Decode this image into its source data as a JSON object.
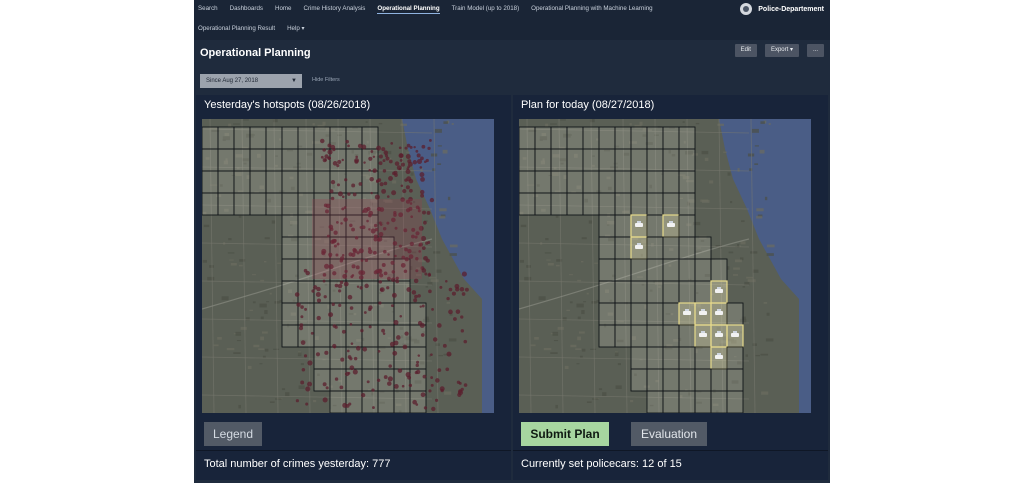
{
  "nav": {
    "row1": [
      "Search",
      "Dashboards",
      "Home",
      "Crime History Analysis",
      "Operational Planning",
      "Train Model (up to 2018)",
      "Operational Planning with Machine Learning"
    ],
    "row2": [
      "Operational Planning Result",
      "Help ▾"
    ],
    "active": "Operational Planning"
  },
  "brand": {
    "name": "Police-Departement",
    "icon": "police-badge-icon"
  },
  "page": {
    "title": "Operational Planning"
  },
  "toolbar": {
    "edit": "Edit",
    "export": "Export ▾",
    "more": "..."
  },
  "filter": {
    "value": "Since Aug 27, 2018",
    "hide_filters": "Hide Filters"
  },
  "left_panel": {
    "title": "Yesterday's hotspots (08/26/2018)",
    "legend_button": "Legend",
    "footer": "Total number of crimes yesterday: 777"
  },
  "right_panel": {
    "title": "Plan for today (08/27/2018)",
    "submit_button": "Submit Plan",
    "evaluation_button": "Evaluation",
    "footer": "Currently set policecars: 12 of 15"
  },
  "colors": {
    "accent_green": "#a7d6a0",
    "panel_bg": "#18243a",
    "app_bg": "#1f2b3d",
    "lake": "#4a5d86"
  }
}
